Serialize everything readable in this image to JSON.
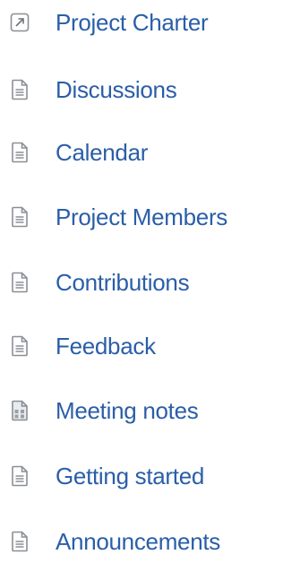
{
  "colors": {
    "link": "#2a5ea8",
    "icon_stroke": "#8a8f96",
    "background": "#ffffff"
  },
  "pages": [
    {
      "label": "Project Charter",
      "icon": "external-link-icon"
    },
    {
      "label": "Discussions",
      "icon": "page-icon"
    },
    {
      "label": "Calendar",
      "icon": "page-icon"
    },
    {
      "label": "Project Members",
      "icon": "page-icon"
    },
    {
      "label": "Contributions",
      "icon": "page-icon"
    },
    {
      "label": "Feedback",
      "icon": "page-icon"
    },
    {
      "label": "Meeting notes",
      "icon": "meeting-notes-icon"
    },
    {
      "label": "Getting started",
      "icon": "page-icon"
    },
    {
      "label": "Announcements",
      "icon": "page-icon"
    }
  ]
}
